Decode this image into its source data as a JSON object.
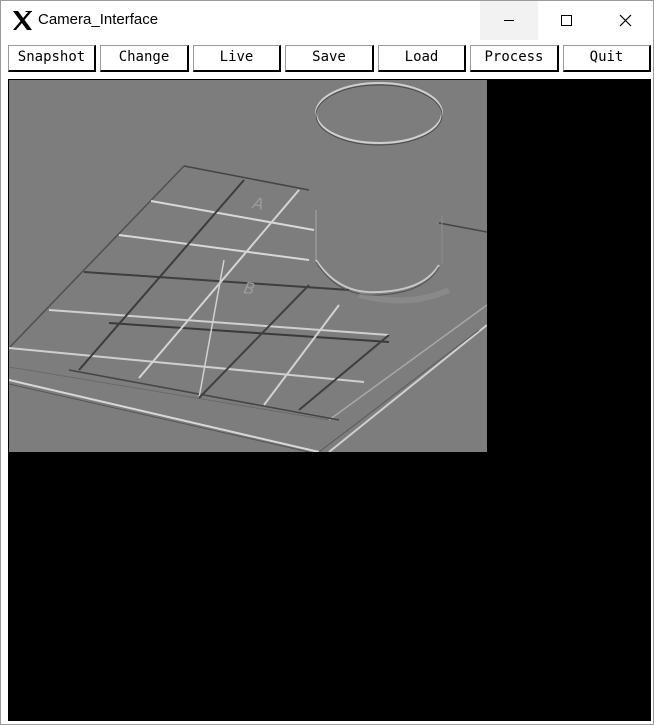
{
  "window": {
    "title": "Camera_Interface",
    "app_icon": "x11-icon",
    "controls": [
      "minimize-icon",
      "maximize-icon",
      "close-icon"
    ]
  },
  "toolbar": {
    "buttons": [
      {
        "label": "Snapshot"
      },
      {
        "label": "Change"
      },
      {
        "label": "Live"
      },
      {
        "label": "Save"
      },
      {
        "label": "Load"
      },
      {
        "label": "Process"
      },
      {
        "label": "Quit"
      }
    ]
  },
  "image": {
    "grid_labels": [
      "A",
      "B"
    ],
    "background_color": "#7d7d7d",
    "canvas_color": "#000000"
  }
}
